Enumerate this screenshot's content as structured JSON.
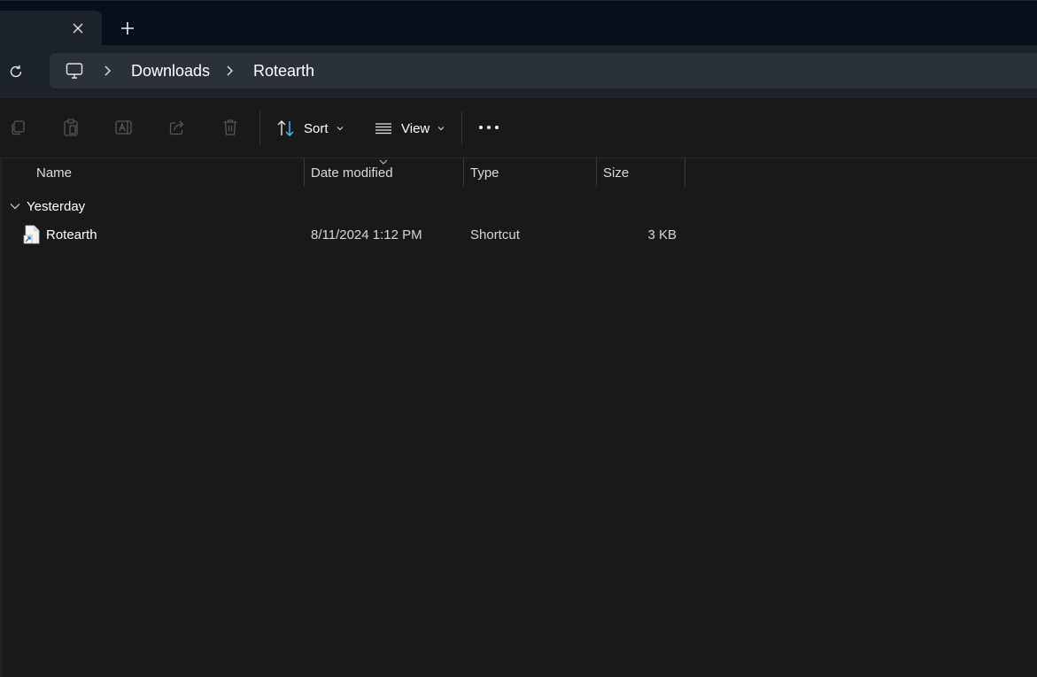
{
  "tab": {
    "close_icon": "close-icon",
    "new_tab_icon": "plus-icon"
  },
  "address": {
    "root_icon": "this-pc-icon",
    "breadcrumbs": [
      "Downloads",
      "Rotearth"
    ]
  },
  "toolbar": {
    "copy_icon": "copy-icon",
    "paste_icon": "paste-icon",
    "rename_icon": "rename-icon",
    "share_icon": "share-icon",
    "delete_icon": "delete-icon",
    "sort_label": "Sort",
    "view_label": "View",
    "more_icon": "more-options-icon"
  },
  "columns": {
    "name": "Name",
    "date_modified": "Date modified",
    "type": "Type",
    "size": "Size"
  },
  "groups": [
    {
      "label": "Yesterday",
      "files": [
        {
          "name": "Rotearth",
          "date_modified": "8/11/2024 1:12 PM",
          "type": "Shortcut",
          "size": "3 KB",
          "icon": "shortcut-file-icon"
        }
      ]
    }
  ],
  "colors": {
    "background": "#191919",
    "tabstrip": "#05101c",
    "address_bar": "#2b3138",
    "accent": "#4cc2ff"
  }
}
